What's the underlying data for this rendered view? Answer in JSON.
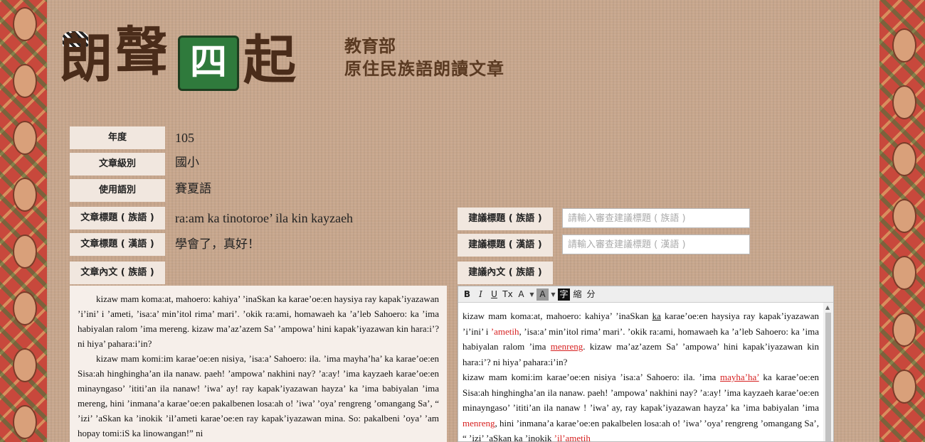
{
  "logo": {
    "chars": [
      "朗",
      "聲",
      "四",
      "起"
    ],
    "icon": "book-logo-icon"
  },
  "header": {
    "ministry": "教育部",
    "subtitle": "原住民族語朗讀文章"
  },
  "fields": {
    "year": {
      "label": "年度",
      "value": "105"
    },
    "level": {
      "label": "文章級別",
      "value": "國小"
    },
    "language": {
      "label": "使用語別",
      "value": "賽夏語"
    },
    "title_native": {
      "label": "文章標題 ( 族語 )",
      "value": "ra:am ka tinotoroe’ ila kin kayzaeh"
    },
    "title_chinese": {
      "label": "文章標題 ( 漢語 )",
      "value": "學會了，真好！"
    },
    "content_native": {
      "label": "文章內文 ( 族語 )"
    }
  },
  "suggest": {
    "title_native": {
      "label": "建議標題 ( 族語 )",
      "placeholder": "請輸入審查建議標題 ( 族語 )"
    },
    "title_chinese": {
      "label": "建議標題 ( 漢語 )",
      "placeholder": "請輸入審查建議標題 ( 漢語 )"
    },
    "content_native": {
      "label": "建議內文 ( 族語 )"
    }
  },
  "toolbar": {
    "bold": "B",
    "italic": "I",
    "underline": "U",
    "clear": "Tx",
    "font_color": "A",
    "bg_color": "A",
    "zi": "字",
    "reduce": "縮",
    "split": "分"
  },
  "article": {
    "p1": "kizaw mam koma:at, mahoero: kahiya’ ’inaSkan ka karae’oe:en haysiya ray kapak’iyazawan ’i’ini’ i ’ameti, ’isa:a’ min’itol rima’ mari’. ’okik ra:ami, homawaeh ka ’a’leb Sahoero: ka ’ima habiyalan ralom ’ima mereng. kizaw ma’az’azem Sa’ ’ampowa’ hini kapak’iyazawan kin hara:i’? ni hiya’ pahara:i’in?",
    "p2": "kizaw mam komi:im karae’oe:en nisiya, ’isa:a’ Sahoero: ila. ’ima mayha’ha’ ka karae’oe:en Sisa:ah hinghingha’an ila nanaw. paeh! ’ampowa’ nakhini nay? ’a:ay! ’ima kayzaeh karae’oe:en minayngaso’ ’ititi’an ila nanaw! ’iwa’ ay! ray kapak’iyazawan hayza’ ka ’ima babiyalan ’ima mereng, hini ’inmana’a karae’oe:en pakalbenen losa:ah o! ’iwa’ ’oya’ rengreng ’omangang Sa’, “ ’izi’ ’aSkan ka ’inokik ’il’ameti karae’oe:en ray kapak’iyazawan mina. So: pakalbeni ’oya’ ’am hopay tomi:iS ka linowangan!” ni"
  },
  "edit": {
    "l1a": "kizaw mam koma:at, mahoero: kahiya’ ’inaSkan ",
    "l1u": "ka",
    "l1b": " karae’oe:en haysiya ray kapak’iyazawan ’i’ini’ i ",
    "l1r": "’ametih",
    "l1c": ", ’isa:a’ min’itol rima’ mari’. ’okik ra:ami, homawaeh ka ’a’leb Sahoero: ka ’ima habiyalan ralom ’ima ",
    "l1r2": "menreng",
    "l1d": ". kizaw ma’az’azem Sa’ ’ampowa’ hini kapak’iyazawan kin hara:i’? ni hiya’ pahara:i’in?",
    "l2a": "kizaw mam komi:im karae’oe:en nisiya ’isa:a’ Sahoero: ila. ’ima ",
    "l2r": "mayha’ha’",
    "l2b": " ka karae’oe:en Sisa:ah hinghingha’an ila nanaw. paeh! ’ampowa’ nakhini nay? ’a:ay! ’ima kayzaeh karae’oe:en minayngaso’ ’ititi’an ila nanaw ! ’iwa’ ay, ray kapak’iyazawan hayza’ ka ’ima babiyalan ’ima ",
    "l2r2": "menreng",
    "l2c": ", hini ’inmana’a karae’oe:en pakalbelen losa:ah o! ’iwa’ ’oya’ rengreng ’omangang Sa’, “ ’izi’ ’aSkan ka ’inokik ",
    "l2r3": "’il’ametih"
  },
  "colors": {
    "accent_red": "#d61f1f",
    "label_bg": "#f1e7df",
    "page_bg": "#c7a68c"
  }
}
